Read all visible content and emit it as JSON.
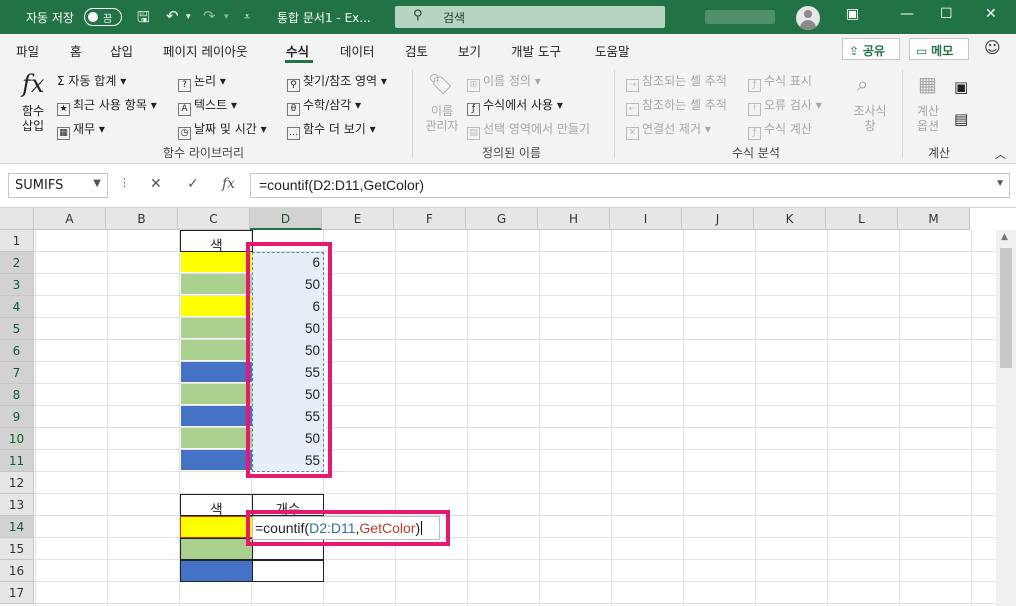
{
  "titlebar": {
    "autosave_label": "자동 저장",
    "toggle_state": "끔",
    "doc_title": "통합 문서1  -  Ex...",
    "search_placeholder": "검색"
  },
  "menu": {
    "tabs": [
      "파일",
      "홈",
      "삽입",
      "페이지 레이아웃",
      "수식",
      "데이터",
      "검토",
      "보기",
      "개발 도구",
      "도움말"
    ],
    "active": "수식",
    "share": "공유",
    "memo": "메모"
  },
  "ribbon": {
    "insert_function": [
      "함수",
      "삽입"
    ],
    "autosum": "자동 합계",
    "recent": "최근 사용 항목",
    "financial": "재무",
    "logical": "논리",
    "text": "텍스트",
    "datetime": "날짜 및 시간",
    "lookup": "찾기/참조 영역",
    "math": "수학/삼각",
    "more": "함수 더 보기",
    "group_library": "함수 라이브러리",
    "name_manager": [
      "이름",
      "관리자"
    ],
    "define_name": "이름 정의",
    "use_in_formula": "수식에서 사용",
    "create_from_sel": "선택 영역에서 만들기",
    "group_names": "정의된 이름",
    "trace_prec": "참조되는 셀 추적",
    "trace_dep": "참조하는 셀 추적",
    "remove_arrows": "연결선 제거",
    "show_formulas": "수식 표시",
    "error_check": "오류 검사",
    "evaluate": "수식 계산",
    "watch": [
      "조사식",
      "창"
    ],
    "group_audit": "수식 분석",
    "calc_options": [
      "계산",
      "옵션"
    ],
    "group_calc": "계산"
  },
  "formula_bar": {
    "name_box": "SUMIFS",
    "cancel": "✕",
    "enter": "✓",
    "fx": "fx",
    "formula": "=countif(D2:D11,GetColor)"
  },
  "sheet": {
    "columns": [
      "A",
      "B",
      "C",
      "D",
      "E",
      "F",
      "G",
      "H",
      "I",
      "J",
      "K",
      "L",
      "M"
    ],
    "rows": [
      "1",
      "2",
      "3",
      "4",
      "5",
      "6",
      "7",
      "8",
      "9",
      "10",
      "11",
      "12",
      "13",
      "14",
      "15",
      "16",
      "17"
    ],
    "header_c1": "색",
    "d_values": [
      "6",
      "50",
      "6",
      "50",
      "50",
      "55",
      "50",
      "55",
      "50",
      "55"
    ],
    "c_colors": [
      "#ffff00",
      "#a9d08e",
      "#ffff00",
      "#a9d08e",
      "#a9d08e",
      "#4472c4",
      "#a9d08e",
      "#4472c4",
      "#a9d08e",
      "#4472c4"
    ],
    "summary_header_color": "색",
    "summary_header_count": "개수",
    "summary_colors": [
      "#ffff00",
      "#a9d08e",
      "#4472c4"
    ],
    "edit_prefix": "=countif(",
    "edit_ref": "D2:D11",
    "edit_comma": ",",
    "edit_arg": "GetColor",
    "edit_suffix": ")"
  },
  "colors": {
    "accent": "#217346",
    "highlight": "#e6196e"
  }
}
